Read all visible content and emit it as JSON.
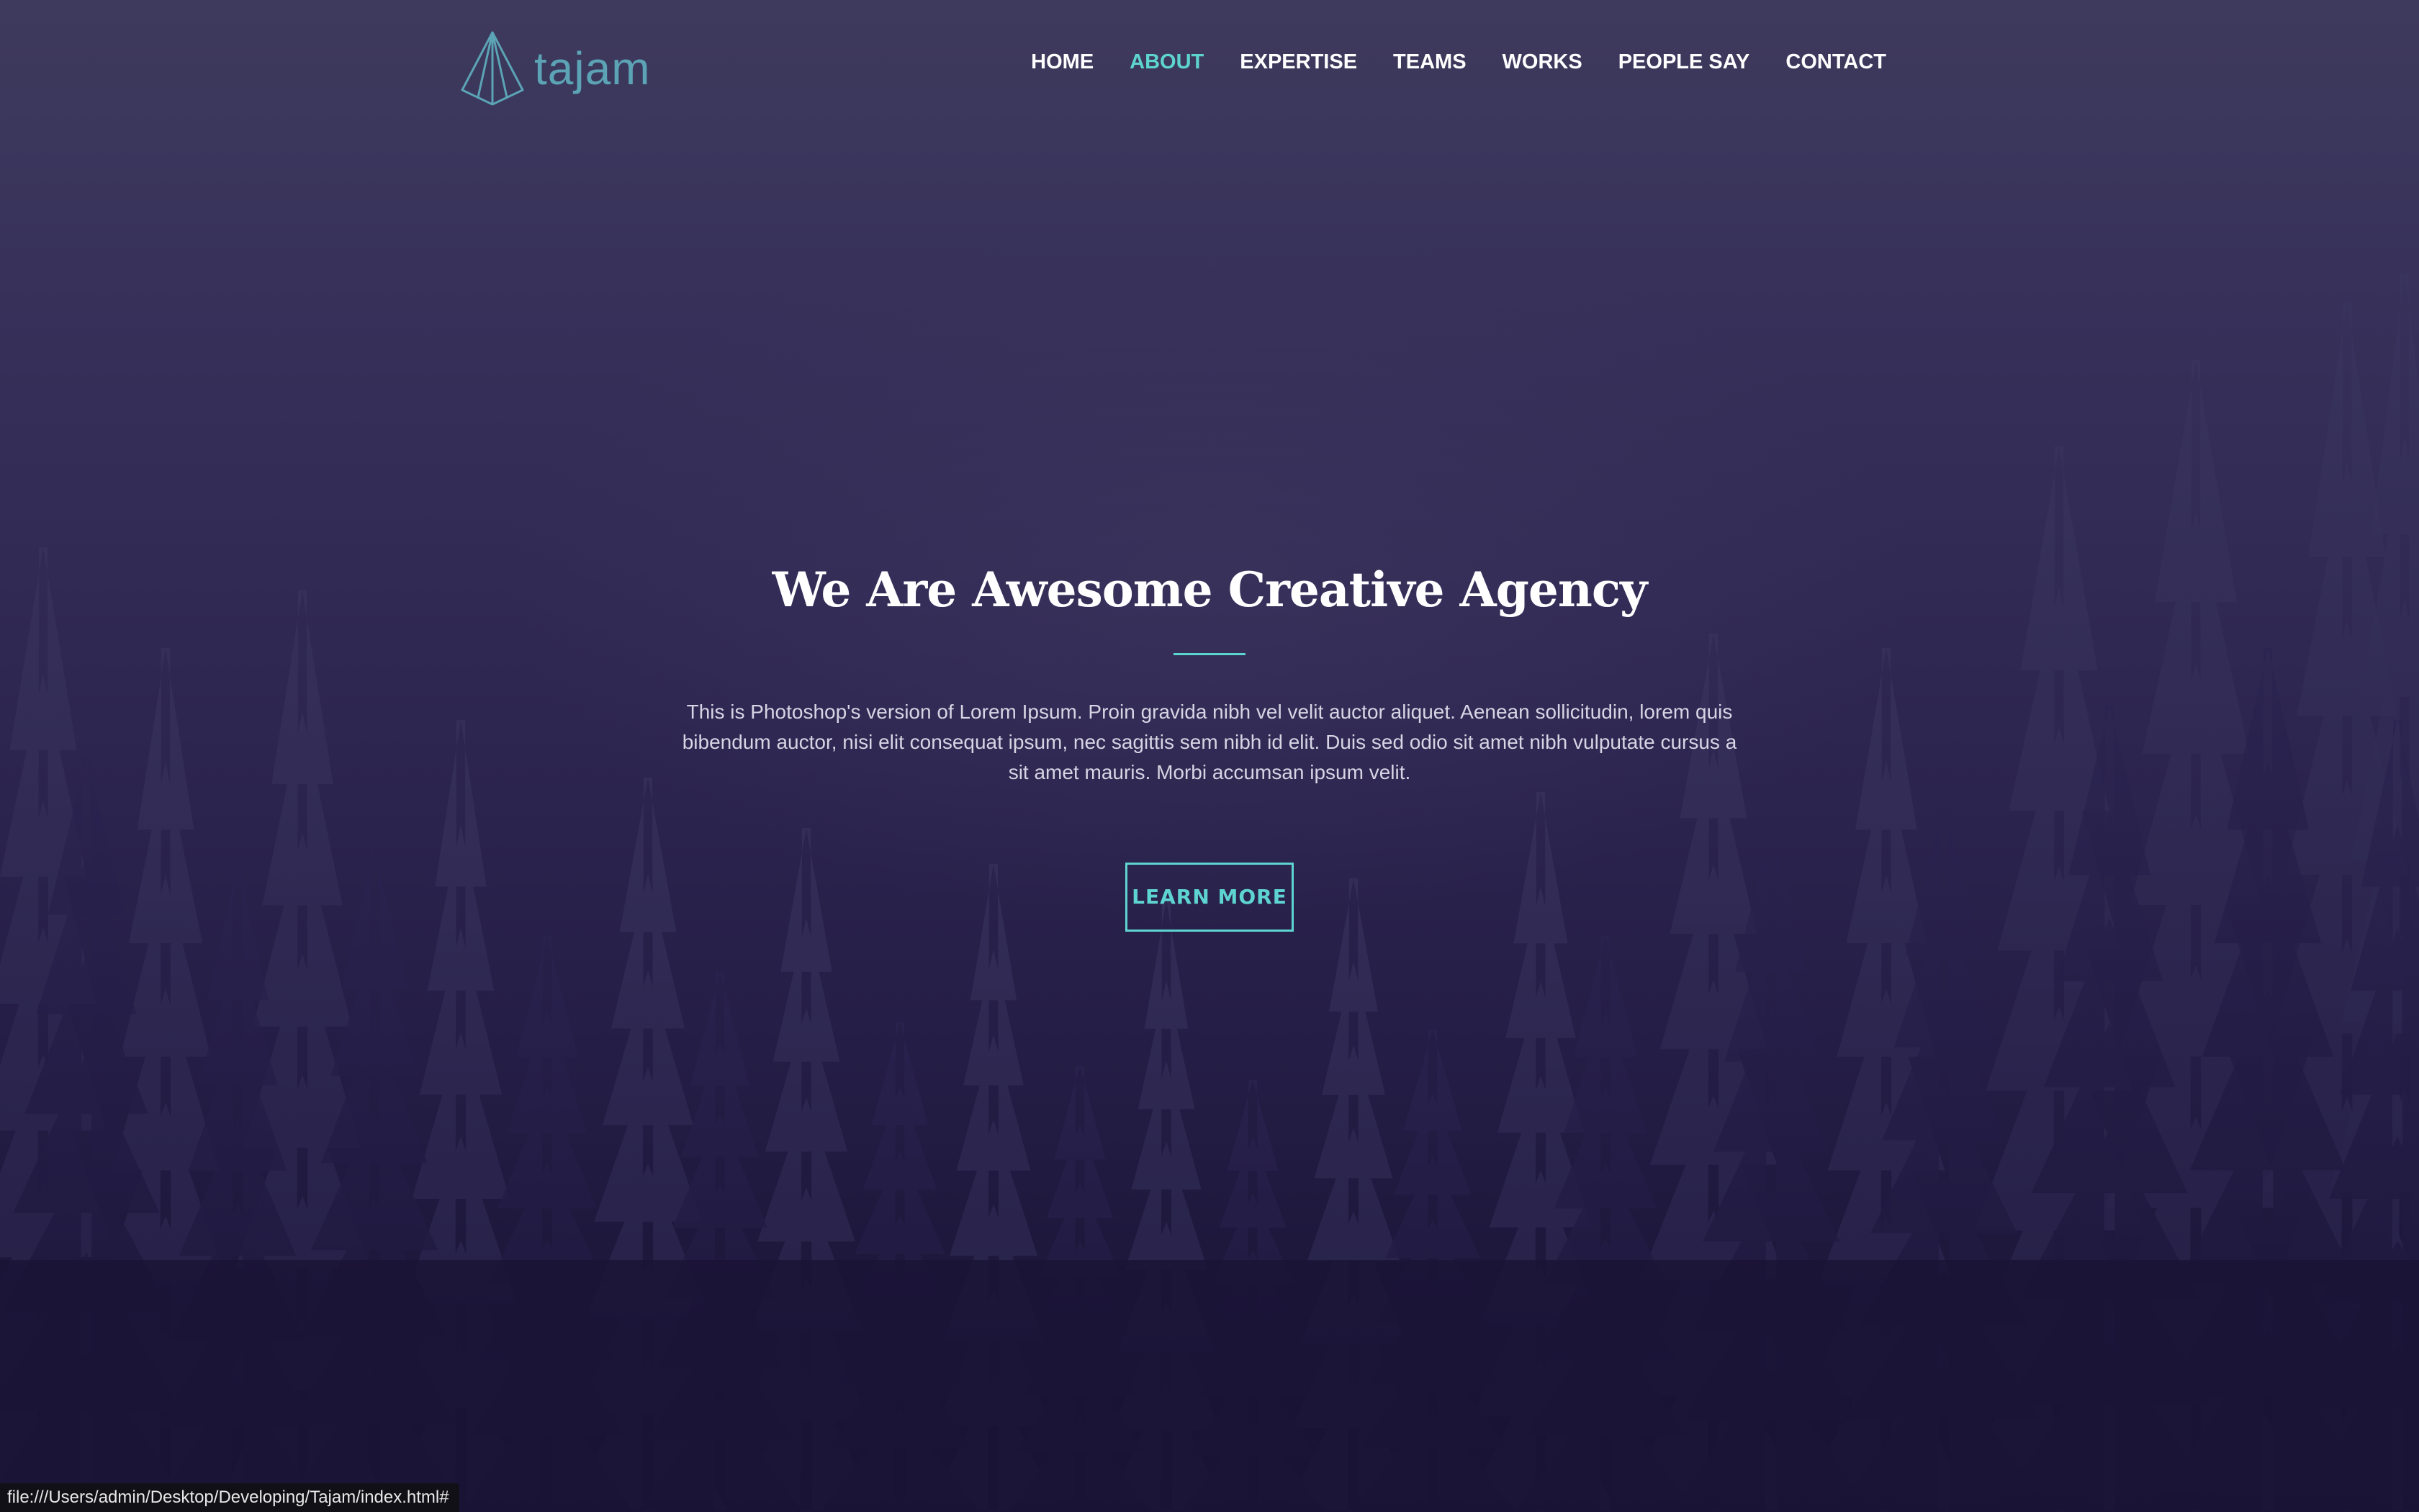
{
  "brand": {
    "name": "tajam",
    "logo_icon": "pyramid-logo-icon",
    "color": "#5ba3b5"
  },
  "nav": {
    "items": [
      {
        "label": "HOME",
        "active": false
      },
      {
        "label": "ABOUT",
        "active": true
      },
      {
        "label": "EXPERTISE",
        "active": false
      },
      {
        "label": "TEAMS",
        "active": false
      },
      {
        "label": "WORKS",
        "active": false
      },
      {
        "label": "PEOPLE SAY",
        "active": false
      },
      {
        "label": "CONTACT",
        "active": false
      }
    ],
    "active_color": "#5ed4d0"
  },
  "hero": {
    "title": "We Are Awesome Creative Agency",
    "description": "This is Photoshop's version of Lorem Ipsum. Proin gravida nibh vel velit auctor aliquet. Aenean sollicitudin, lorem quis bibendum auctor, nisi elit consequat ipsum, nec sagittis sem nibh id elit. Duis sed odio sit amet nibh vulputate cursus a sit amet mauris. Morbi accumsan ipsum velit.",
    "cta_label": "LEARN MORE",
    "accent_color": "#5ed4d0"
  },
  "status_bar": {
    "url": "file:///Users/admin/Desktop/Developing/Tajam/index.html#"
  }
}
